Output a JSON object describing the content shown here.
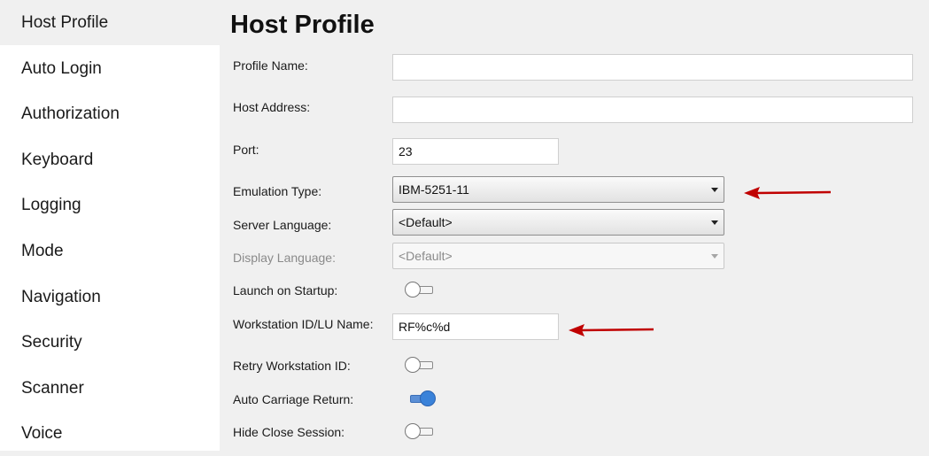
{
  "sidebar": {
    "items": [
      {
        "label": "Host Profile"
      },
      {
        "label": "Auto Login"
      },
      {
        "label": "Authorization"
      },
      {
        "label": "Keyboard"
      },
      {
        "label": "Logging"
      },
      {
        "label": "Mode"
      },
      {
        "label": "Navigation"
      },
      {
        "label": "Security"
      },
      {
        "label": "Scanner"
      },
      {
        "label": "Voice"
      }
    ]
  },
  "main": {
    "title": "Host Profile",
    "fields": {
      "profile_name": {
        "label": "Profile Name:",
        "value": ""
      },
      "host_address": {
        "label": "Host Address:",
        "value": ""
      },
      "port": {
        "label": "Port:",
        "value": "23"
      },
      "emulation_type": {
        "label": "Emulation Type:",
        "value": "IBM-5251-11"
      },
      "server_language": {
        "label": "Server Language:",
        "value": "<Default>"
      },
      "display_language": {
        "label": "Display Language:",
        "value": "<Default>"
      },
      "launch_on_startup": {
        "label": "Launch on Startup:",
        "on": false
      },
      "workstation_id": {
        "label": "Workstation ID/LU Name:",
        "value": "RF%c%d"
      },
      "retry_workstation_id": {
        "label": "Retry Workstation ID:",
        "on": false
      },
      "auto_carriage_return": {
        "label": "Auto Carriage Return:",
        "on": true
      },
      "hide_close_session": {
        "label": "Hide Close Session:",
        "on": false
      }
    }
  },
  "colors": {
    "sidebar_bg": "#ffffff",
    "content_bg": "#f0f0f0",
    "toggle_on": "#3a82d9",
    "annotation_arrow": "#c00000"
  },
  "icons": {
    "dropdown": "chevron-down-icon",
    "annotation": "red-arrow-icon"
  }
}
